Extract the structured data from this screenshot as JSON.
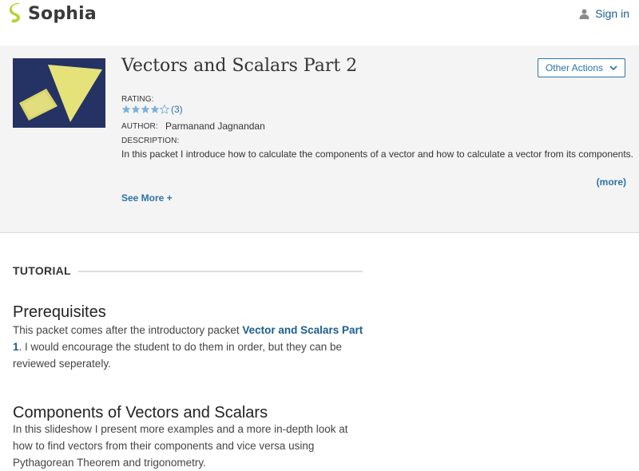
{
  "brand": {
    "name": "Sophia",
    "accent": "#b5d334"
  },
  "topbar": {
    "signin_label": "Sign in",
    "signin_icon": "user-icon"
  },
  "packet": {
    "title": "Vectors and Scalars Part 2",
    "other_actions_label": "Other Actions",
    "rating_label": "RATING:",
    "rating_value": 4,
    "rating_max": 5,
    "rating_count": "(3)",
    "author_label": "AUTHOR:",
    "author_name": "Parmanand Jagnandan",
    "description_label": "DESCRIPTION:",
    "description": "In this packet I introduce how to calculate the components of a vector and how to calculate a vector from its components.",
    "more_label": "(more)",
    "see_more_label": "See More +"
  },
  "tutorial": {
    "label": "TUTORIAL",
    "sections": [
      {
        "heading": "Prerequisites",
        "text_before": "This packet comes after the introductory packet ",
        "link": "Vector and Scalars Part 1",
        "text_after": ". I would encourage the student to do them in order, but they can be reviewed seperately."
      },
      {
        "heading": "Components of Vectors and Scalars",
        "text": "In this slideshow I present more examples and a more in-depth look at how to find vectors from their components and vice versa using Pythagorean Theorem and trigonometry."
      }
    ]
  },
  "colors": {
    "link": "#2a73a8",
    "header_bg": "#f4f4f4"
  }
}
